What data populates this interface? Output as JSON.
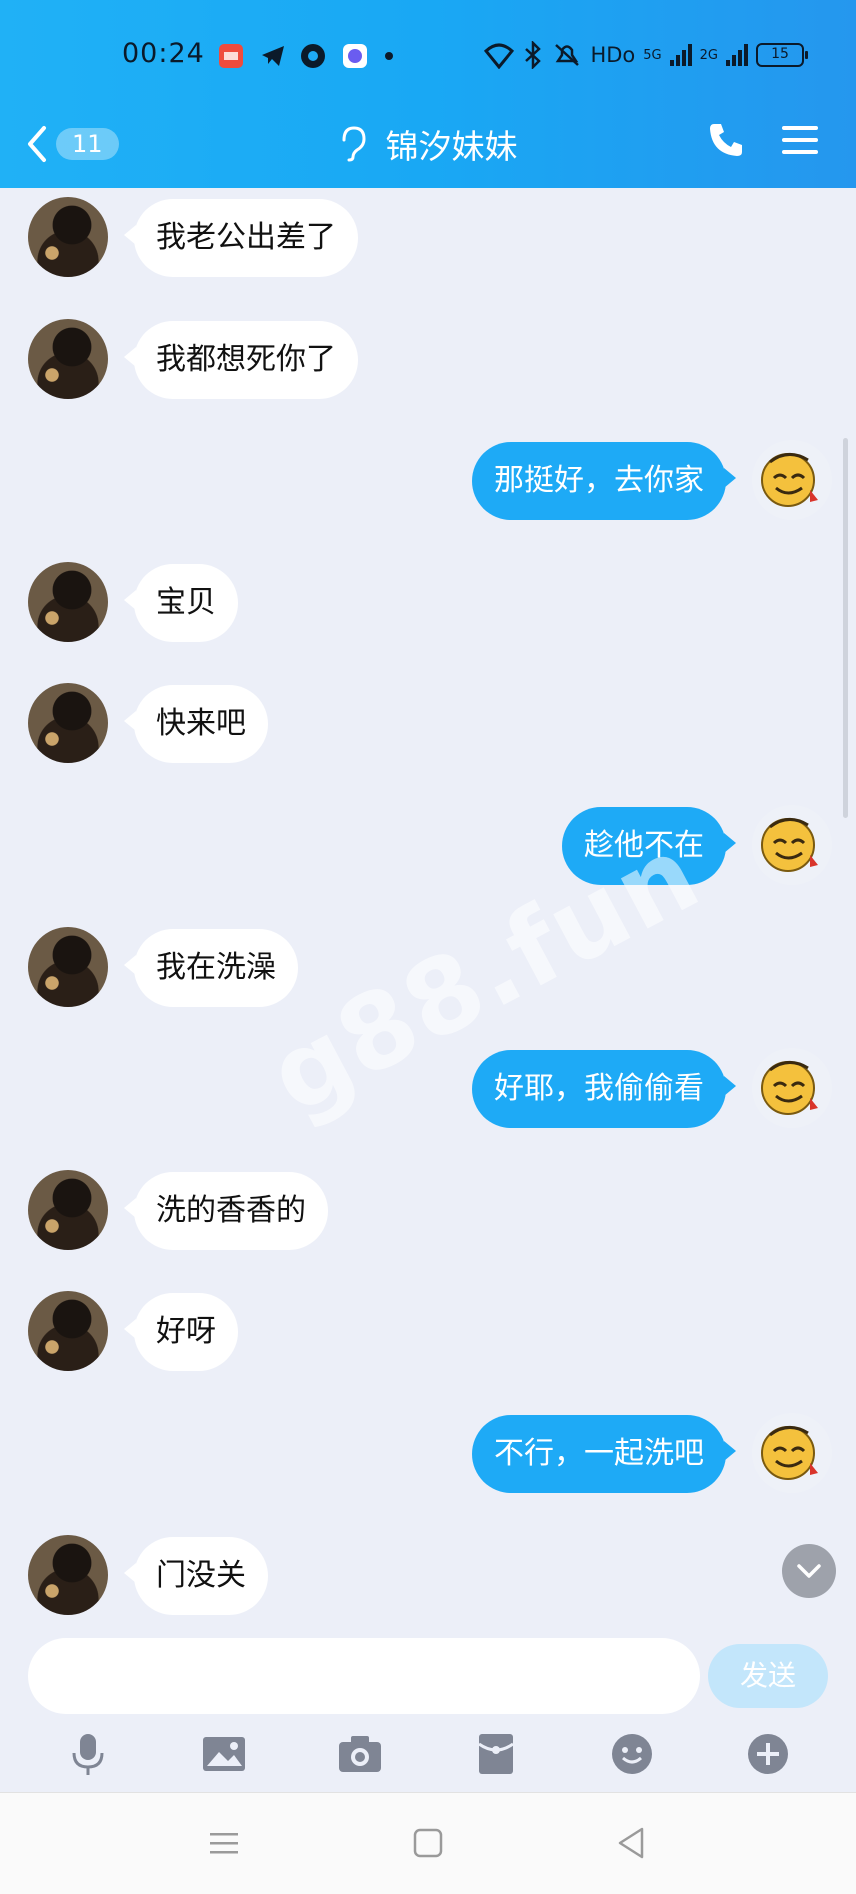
{
  "status_bar": {
    "time": "00:24",
    "network_label": "HDo",
    "signal_1_label": "5G",
    "signal_2_label": "2G",
    "battery": "15"
  },
  "header": {
    "back_badge": "11",
    "title": "锦汐妹妹",
    "phone_icon": "phone-icon",
    "menu_icon": "menu-icon"
  },
  "messages": [
    {
      "side": "left",
      "text": "我老公出差了"
    },
    {
      "side": "left",
      "text": "我都想死你了"
    },
    {
      "side": "right",
      "text": "那挺好，去你家"
    },
    {
      "side": "left",
      "text": "宝贝"
    },
    {
      "side": "left",
      "text": "快来吧"
    },
    {
      "side": "right",
      "text": "趁他不在"
    },
    {
      "side": "left",
      "text": "我在洗澡"
    },
    {
      "side": "right",
      "text": "好耶，我偷偷看"
    },
    {
      "side": "left",
      "text": "洗的香香的"
    },
    {
      "side": "left",
      "text": "好呀"
    },
    {
      "side": "right",
      "text": "不行，一起洗吧"
    },
    {
      "side": "left",
      "text": "门没关"
    }
  ],
  "watermark": "g88.fun",
  "composer": {
    "input_value": "",
    "send_label": "发送"
  },
  "toolbar": [
    "microphone-icon",
    "image-icon",
    "camera-icon",
    "red-packet-icon",
    "emoji-icon",
    "plus-icon"
  ],
  "colors": {
    "header": "#1eaaf6",
    "bubble_right": "#1eaaf6",
    "bubble_left": "#ffffff",
    "background": "#eceff8",
    "send_disabled": "#c3e6fb"
  }
}
